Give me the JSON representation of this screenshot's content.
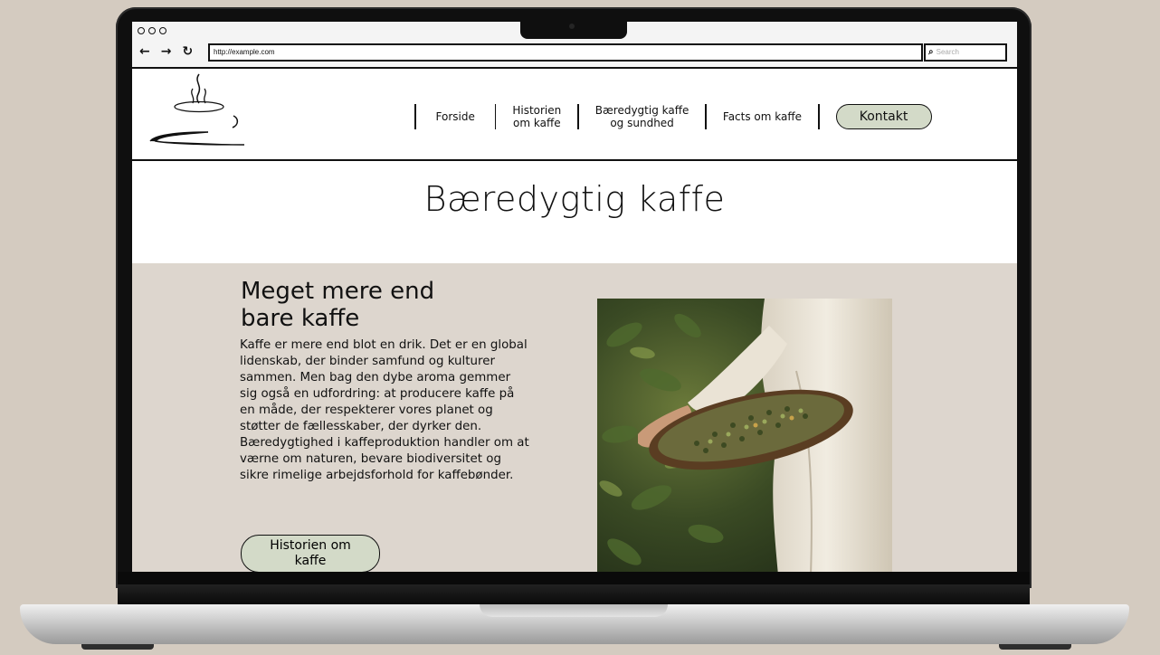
{
  "browser": {
    "url": "http://example.com",
    "search_placeholder": "Search",
    "back": "←",
    "forward": "→",
    "reload": "↻"
  },
  "nav": {
    "items": [
      {
        "label": "Forside"
      },
      {
        "label_line1": "Historien",
        "label_line2": "om kaffe"
      },
      {
        "label_line1": "Bæredygtig kaffe",
        "label_line2": "og sundhed"
      },
      {
        "label": "Facts om kaffe"
      }
    ],
    "contact": "Kontakt"
  },
  "page": {
    "title": "Bæredygtig kaffe"
  },
  "section": {
    "heading_line1": "Meget mere end",
    "heading_line2": "bare kaffe",
    "body": "Kaffe er mere end blot en drik. Det er en global lidenskab, der binder samfund og kulturer sammen. Men bag den dybe aroma gemmer sig også en udfordring: at producere kaffe på en måde, der respekterer vores planet og støtter de fællesskaber, der dyrker den. Bæredygtighed i kaffeproduktion handler om at værne om naturen, bevare biodiversitet og sikre rimelige arbejdsforhold for kaffebønder.",
    "button_line1": "Historien om",
    "button_line2": "kaffe"
  },
  "colors": {
    "content_bg": "#ddd6ce",
    "button_bg": "#d3dac8",
    "page_bg": "#d4cbc0"
  }
}
